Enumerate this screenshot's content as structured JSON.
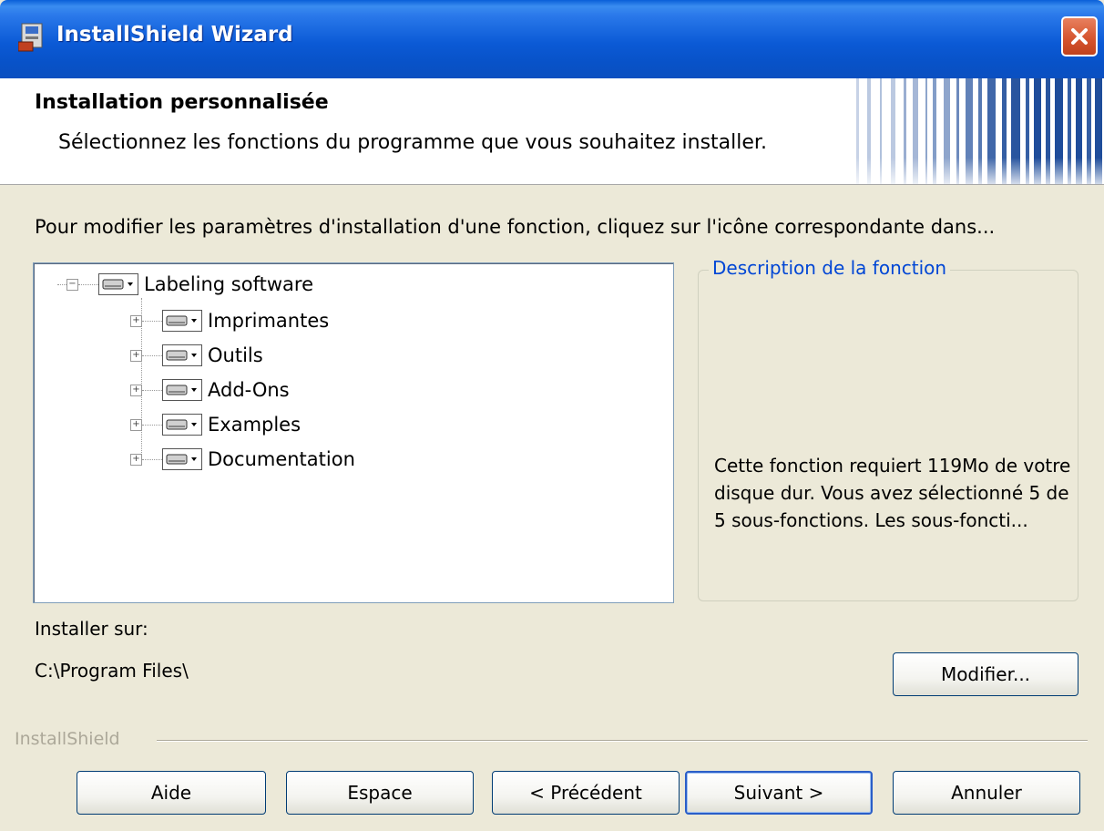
{
  "window": {
    "title": "InstallShield Wizard"
  },
  "header": {
    "title": "Installation personnalisée",
    "subtitle": "Sélectionnez les fonctions du programme que vous souhaitez installer."
  },
  "instructions": "Pour modifier les paramètres d'installation d'une fonction, cliquez sur l'icône correspondante dans...",
  "tree": {
    "root": {
      "label": "Labeling software",
      "expander": "−"
    },
    "children": [
      {
        "label": "Imprimantes",
        "expander": "+"
      },
      {
        "label": "Outils",
        "expander": "+"
      },
      {
        "label": "Add-Ons",
        "expander": "+"
      },
      {
        "label": "Examples",
        "expander": "+"
      },
      {
        "label": "Documentation",
        "expander": "+"
      }
    ]
  },
  "description": {
    "legend": "Description de la fonction",
    "text": "Cette fonction requiert 119Mo de votre disque dur. Vous avez sélectionné 5 de 5 sous-fonctions. Les sous-foncti..."
  },
  "install_to": {
    "label": "Installer sur:",
    "path": "C:\\Program Files\\"
  },
  "buttons": {
    "modify": "Modifier...",
    "help": "Aide",
    "space": "Espace",
    "back": "< Précédent",
    "next": "Suivant >",
    "cancel": "Annuler"
  },
  "brand": "InstallShield",
  "colors": {
    "titlebar": "#0a5fd8",
    "close": "#d4522d",
    "legend": "#0046d5",
    "dialog_bg": "#ece9d8"
  },
  "icons": {
    "app": "installer-icon",
    "close": "close-icon",
    "feature": "hard-drive-icon",
    "dropdown": "dropdown-arrow-icon"
  }
}
